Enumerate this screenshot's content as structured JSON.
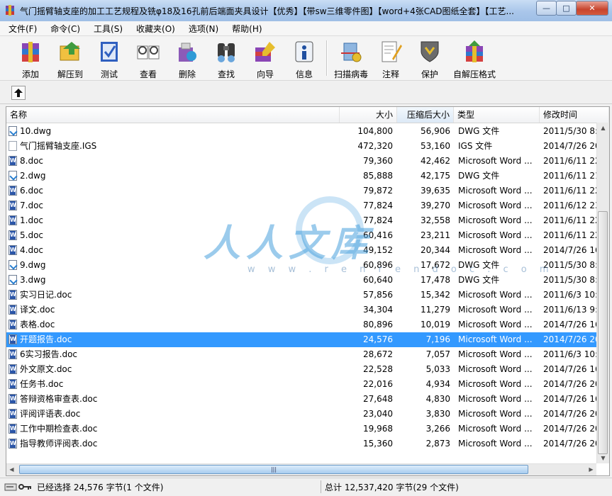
{
  "window": {
    "title": "气门摇臂轴支座的加工工艺规程及铣φ18及16孔前后端面夹具设计【优秀】【带sw三维零件图】【word+4张CAD图纸全套】【工艺...",
    "controls": {
      "minimize": "—",
      "maximize": "□",
      "close": "✕"
    }
  },
  "menu": [
    "文件(F)",
    "命令(C)",
    "工具(S)",
    "收藏夹(O)",
    "选项(N)",
    "帮助(H)"
  ],
  "toolbar": [
    {
      "label": "添加",
      "icon": "add-archive-icon"
    },
    {
      "label": "解压到",
      "icon": "extract-to-icon"
    },
    {
      "label": "测试",
      "icon": "test-icon"
    },
    {
      "label": "查看",
      "icon": "view-icon"
    },
    {
      "label": "删除",
      "icon": "delete-icon"
    },
    {
      "label": "查找",
      "icon": "find-icon"
    },
    {
      "label": "向导",
      "icon": "wizard-icon"
    },
    {
      "label": "信息",
      "icon": "info-icon"
    },
    {
      "label": "扫描病毒",
      "icon": "virus-scan-icon"
    },
    {
      "label": "注释",
      "icon": "comment-icon"
    },
    {
      "label": "保护",
      "icon": "protect-icon"
    },
    {
      "label": "自解压格式",
      "icon": "sfx-icon"
    }
  ],
  "columns": {
    "name": "名称",
    "size": "大小",
    "packed": "压缩后大小",
    "type": "类型",
    "modified": "修改时间"
  },
  "files": [
    {
      "name": "10.dwg",
      "size": "104,800",
      "packed": "56,906",
      "type": "DWG 文件",
      "modified": "2011/5/30 8:",
      "kind": "dwg"
    },
    {
      "name": "气门摇臂轴支座.IGS",
      "size": "472,320",
      "packed": "53,160",
      "type": "IGS 文件",
      "modified": "2014/7/26 20",
      "kind": "igs"
    },
    {
      "name": "8.doc",
      "size": "79,360",
      "packed": "42,462",
      "type": "Microsoft Word ...",
      "modified": "2011/6/11 22",
      "kind": "word"
    },
    {
      "name": "2.dwg",
      "size": "85,888",
      "packed": "42,175",
      "type": "DWG 文件",
      "modified": "2011/6/11 21",
      "kind": "dwg"
    },
    {
      "name": "6.doc",
      "size": "79,872",
      "packed": "39,635",
      "type": "Microsoft Word ...",
      "modified": "2011/6/11 22",
      "kind": "word"
    },
    {
      "name": "7.doc",
      "size": "77,824",
      "packed": "39,270",
      "type": "Microsoft Word ...",
      "modified": "2011/6/12 23",
      "kind": "word"
    },
    {
      "name": "1.doc",
      "size": "77,824",
      "packed": "32,558",
      "type": "Microsoft Word ...",
      "modified": "2011/6/11 22",
      "kind": "word"
    },
    {
      "name": "5.doc",
      "size": "60,416",
      "packed": "23,211",
      "type": "Microsoft Word ...",
      "modified": "2011/6/11 22",
      "kind": "word"
    },
    {
      "name": "4.doc",
      "size": "49,152",
      "packed": "20,344",
      "type": "Microsoft Word ...",
      "modified": "2014/7/26 16",
      "kind": "word"
    },
    {
      "name": "9.dwg",
      "size": "60,896",
      "packed": "17,672",
      "type": "DWG 文件",
      "modified": "2011/5/30 8:",
      "kind": "dwg"
    },
    {
      "name": "3.dwg",
      "size": "60,640",
      "packed": "17,478",
      "type": "DWG 文件",
      "modified": "2011/5/30 8:",
      "kind": "dwg"
    },
    {
      "name": "实习日记.doc",
      "size": "57,856",
      "packed": "15,342",
      "type": "Microsoft Word ...",
      "modified": "2011/6/3 10:",
      "kind": "word"
    },
    {
      "name": "译文.doc",
      "size": "34,304",
      "packed": "11,279",
      "type": "Microsoft Word ...",
      "modified": "2011/6/13 9:",
      "kind": "word"
    },
    {
      "name": "表格.doc",
      "size": "80,896",
      "packed": "10,019",
      "type": "Microsoft Word ...",
      "modified": "2014/7/26 16",
      "kind": "word"
    },
    {
      "name": "开题报告.doc",
      "size": "24,576",
      "packed": "7,196",
      "type": "Microsoft Word ...",
      "modified": "2014/7/26 20",
      "kind": "word",
      "selected": true
    },
    {
      "name": "6实习报告.doc",
      "size": "28,672",
      "packed": "7,057",
      "type": "Microsoft Word ...",
      "modified": "2011/6/3 10:",
      "kind": "word"
    },
    {
      "name": "外文原文.doc",
      "size": "22,528",
      "packed": "5,033",
      "type": "Microsoft Word ...",
      "modified": "2014/7/26 16",
      "kind": "word"
    },
    {
      "name": "任务书.doc",
      "size": "22,016",
      "packed": "4,934",
      "type": "Microsoft Word ...",
      "modified": "2014/7/26 20",
      "kind": "word"
    },
    {
      "name": "答辩资格审查表.doc",
      "size": "27,648",
      "packed": "4,830",
      "type": "Microsoft Word ...",
      "modified": "2014/7/26 16",
      "kind": "word"
    },
    {
      "name": "评阅评语表.doc",
      "size": "23,040",
      "packed": "3,830",
      "type": "Microsoft Word ...",
      "modified": "2014/7/26 20",
      "kind": "word"
    },
    {
      "name": "工作中期检查表.doc",
      "size": "19,968",
      "packed": "3,266",
      "type": "Microsoft Word ...",
      "modified": "2014/7/26 20",
      "kind": "word"
    },
    {
      "name": "指导教师评阅表.doc",
      "size": "15,360",
      "packed": "2,873",
      "type": "Microsoft Word ...",
      "modified": "2014/7/26 20",
      "kind": "word"
    }
  ],
  "watermark": {
    "text": "人人文库",
    "url": "w w w . r e n r e n d o c . c o m"
  },
  "status": {
    "left": "已经选择 24,576 字节(1 个文件)",
    "right": "总计 12,537,420 字节(29 个文件)"
  },
  "colors": {
    "selection": "#3399ff",
    "titlebar": "#a9c6ea"
  }
}
